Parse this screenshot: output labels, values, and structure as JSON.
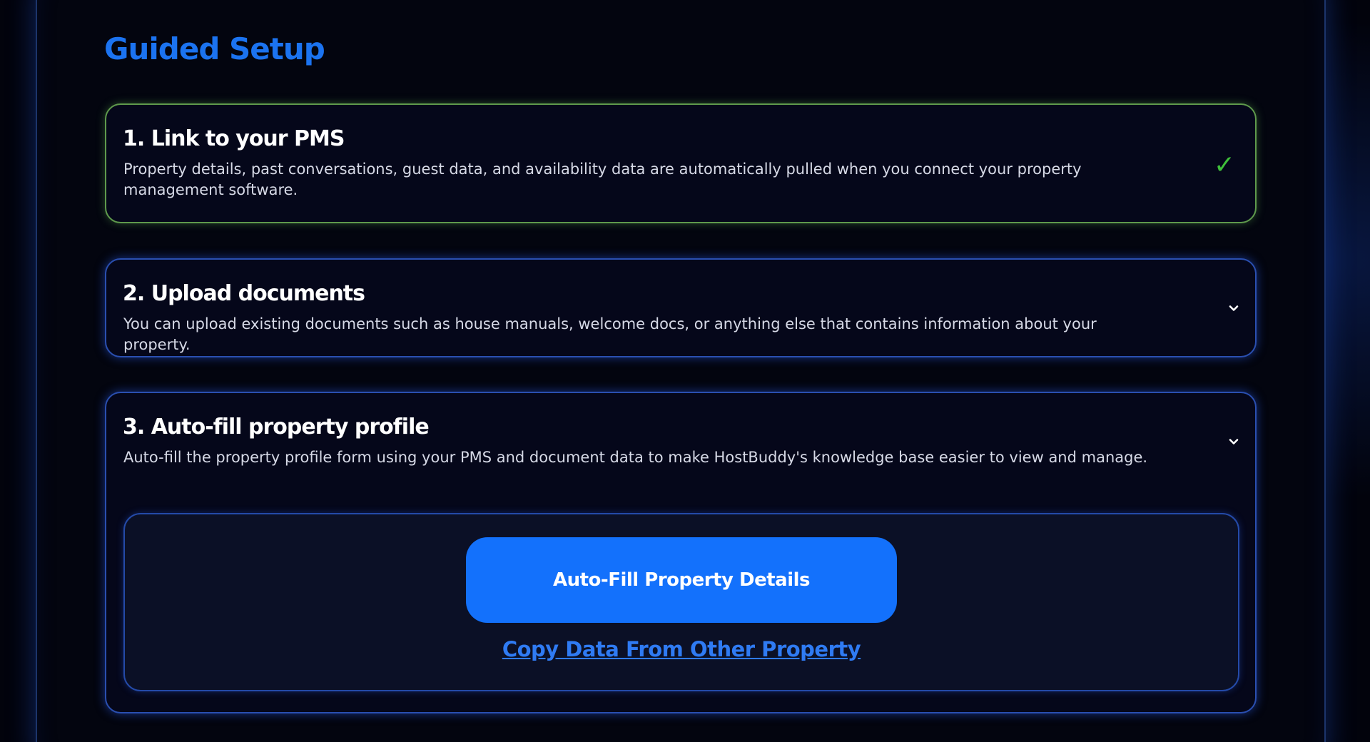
{
  "page": {
    "title": "Guided Setup"
  },
  "steps": [
    {
      "title": "1. Link to your PMS",
      "description": "Property details, past conversations, guest data, and availability data are automatically pulled when you connect your property management software.",
      "status": "complete",
      "status_icon": "check-icon",
      "status_glyph": "✓"
    },
    {
      "title": "2. Upload documents",
      "description": "You can upload existing documents such as house manuals, welcome docs, or anything else that contains information about your property.",
      "status": "collapsed",
      "status_icon": "chevron-down-icon"
    },
    {
      "title": "3. Auto-fill property profile",
      "description": "Auto-fill the property profile form using your PMS and document data to make HostBuddy's knowledge base easier to view and manage.",
      "status": "expanded",
      "status_icon": "chevron-down-icon",
      "primary_button": "Auto-Fill Property Details",
      "secondary_link": "Copy Data From Other Property"
    }
  ],
  "colors": {
    "accent": "#1371fc",
    "title": "#1b73f0",
    "complete": "#3fbf3a",
    "complete_border": "#5f9a4c",
    "card_border": "#2a4fb0",
    "background": "#02030c"
  }
}
